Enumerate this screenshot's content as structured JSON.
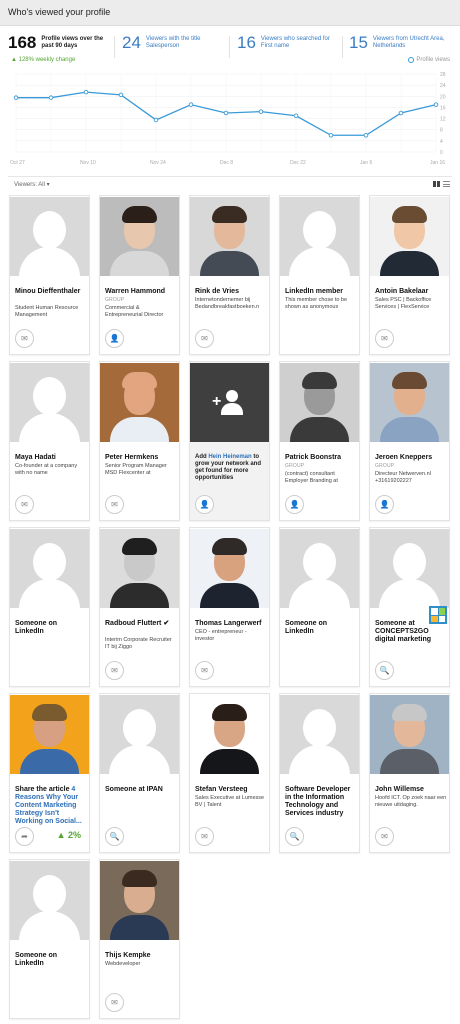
{
  "header": {
    "title": "Who's viewed your profile"
  },
  "summary": {
    "primary": {
      "value": "168",
      "label": "Profile views over the past 90 days"
    },
    "stats": [
      {
        "value": "24",
        "label": "Viewers with the title Salesperson"
      },
      {
        "value": "16",
        "label": "Viewers who searched for First name"
      },
      {
        "value": "15",
        "label": "Viewers from Utrecht Area, Netherlands"
      }
    ],
    "weekly_change": "▲ 128% weekly change",
    "legend": "Profile views"
  },
  "chart_data": {
    "type": "line",
    "x": [
      "Oct 27",
      "Nov 3",
      "Nov 10",
      "Nov 17",
      "Nov 24",
      "Dec 1",
      "Dec 8",
      "Dec 15",
      "Dec 22",
      "Dec 29",
      "Jan 5",
      "Jan 12",
      "Jan 16"
    ],
    "x_tick_labels": [
      "Oct 27",
      "Nov 10",
      "Nov 24",
      "Dec 8",
      "Dec 22",
      "Jan 5",
      "Jan 16"
    ],
    "series": [
      {
        "name": "Profile views",
        "values": [
          19.5,
          19.5,
          21.5,
          20.5,
          11.5,
          17,
          14,
          14.5,
          13,
          6,
          6,
          14,
          17
        ]
      }
    ],
    "ylim": [
      0,
      28
    ],
    "y_ticks": [
      "0",
      "4",
      "8",
      "12",
      "16",
      "20",
      "24",
      "28"
    ],
    "grid": true,
    "color": "#3a9ad9"
  },
  "filter": {
    "label": "Viewers: All ▾"
  },
  "cards": [
    {
      "name": "Minou Dieffenthaler",
      "group": "",
      "title": "Student Human Resource Management",
      "action": "mail",
      "photo": "silhouette"
    },
    {
      "name": "Warren Hammond",
      "group": "GROUP",
      "title": "Commercial & Entrepreneurial Director",
      "action": "person",
      "photo": "face1"
    },
    {
      "name": "Rink de Vries",
      "group": "",
      "title": "Internetondernemer bij Bedandbreakfastboeken.n",
      "action": "mail",
      "photo": "face2"
    },
    {
      "name": "LinkedIn member",
      "group": "",
      "title": "This member chose to be shown as anonymous",
      "action": "",
      "photo": "silhouette"
    },
    {
      "name": "Antoin Bakelaar",
      "group": "",
      "title": "Sales PSC | Backoffice Services | FlexService",
      "action": "mail",
      "photo": "face3"
    },
    {
      "name": "Maya Hadati",
      "group": "",
      "title": "Co-founder at a company with no name",
      "action": "mail",
      "photo": "silhouette"
    },
    {
      "name": "Peter Hermkens",
      "group": "",
      "title": "Senior Program Manager MSD Flexcenter at",
      "action": "mail",
      "photo": "face4"
    },
    {
      "name": "",
      "group": "",
      "title_prefix": "Add ",
      "title_link": "Hein Heineman",
      "title": " to grow your network and get found for more opportunities",
      "action": "person",
      "photo": "add"
    },
    {
      "name": "Patrick Boonstra",
      "group": "GROUP",
      "title": "(contract) consultant Employer Branding at",
      "action": "person",
      "photo": "face5"
    },
    {
      "name": "Jeroen Kneppers",
      "group": "GROUP",
      "title": "Directeur Netwerven.nl +31619202227",
      "action": "person",
      "photo": "face6"
    },
    {
      "name": "Someone on LinkedIn",
      "group": "",
      "title": "",
      "action": "",
      "photo": "silhouette"
    },
    {
      "name": "Radboud Fluttert ✔",
      "group": "",
      "title": "Interim Corporate Recruiter IT bij Ziggo",
      "action": "mail",
      "photo": "face7"
    },
    {
      "name": "Thomas Langerwerf",
      "group": "",
      "title": "CEO - entrepreneur - investor",
      "action": "mail",
      "photo": "face8"
    },
    {
      "name": "Someone on LinkedIn",
      "group": "",
      "title": "",
      "action": "",
      "photo": "silhouette"
    },
    {
      "name": "Someone at CONCEPTS2GO digital marketing",
      "group": "",
      "title": "",
      "action": "search",
      "photo": "silhouette",
      "badge": true
    },
    {
      "name": "Share the article ",
      "name_link": "4 Reasons Why Your Content Marketing Strategy Isn't Working on Social...",
      "group": "",
      "title": "",
      "action": "share",
      "photo": "face9",
      "pct": "▲ 2%"
    },
    {
      "name": "Someone at IPAN",
      "group": "",
      "title": "",
      "action": "search",
      "photo": "silhouette"
    },
    {
      "name": "Stefan Versteeg",
      "group": "",
      "title": "Sales Executive at Lumesse BV | Talent",
      "action": "mail",
      "photo": "face10"
    },
    {
      "name": "Software Developer in the Information Technology and Services industry",
      "group": "",
      "title": "",
      "action": "search",
      "photo": "silhouette"
    },
    {
      "name": "John Willemse",
      "group": "",
      "title": "Hoofd ICT. Op zoek naar een nieuwe uitdaging.",
      "action": "mail",
      "photo": "face11"
    },
    {
      "name": "Someone on LinkedIn",
      "group": "",
      "title": "",
      "action": "",
      "photo": "silhouette"
    },
    {
      "name": "Thijs Kempke",
      "group": "",
      "title": "Webdeveloper",
      "action": "mail",
      "photo": "face12"
    }
  ]
}
